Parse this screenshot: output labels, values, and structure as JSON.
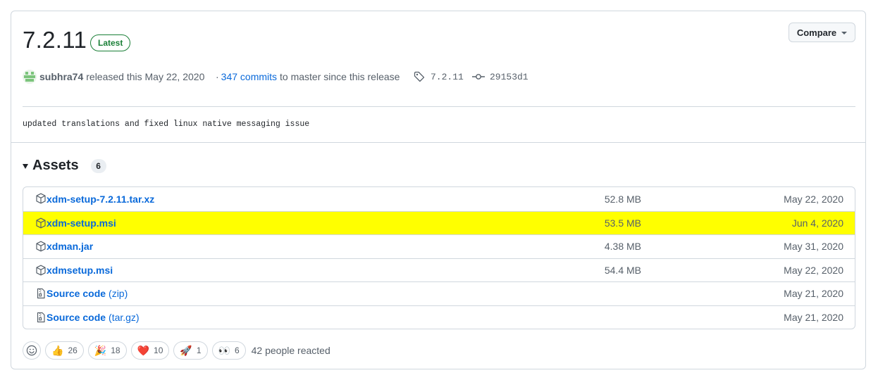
{
  "release": {
    "version": "7.2.11",
    "badge": "Latest",
    "compare_label": "Compare",
    "author": "subhra74",
    "released_text": "released this May 22, 2020",
    "commits_prefix": "·",
    "commits_link": "347 commits",
    "commits_suffix": "to master since this release",
    "tag": "7.2.11",
    "commit_hash": "29153d1",
    "notes": "updated translations and fixed linux native messaging issue"
  },
  "assets": {
    "title": "Assets",
    "count": "6",
    "rows": [
      {
        "name": "xdm-setup-7.2.11.tar.xz",
        "ext": "",
        "size": "52.8 MB",
        "date": "May 22, 2020",
        "icon": "package-icon",
        "highlight": false
      },
      {
        "name": "xdm-setup.msi",
        "ext": "",
        "size": "53.5 MB",
        "date": "Jun 4, 2020",
        "icon": "package-icon",
        "highlight": true
      },
      {
        "name": "xdman.jar",
        "ext": "",
        "size": "4.38 MB",
        "date": "May 31, 2020",
        "icon": "package-icon",
        "highlight": false
      },
      {
        "name": "xdmsetup.msi",
        "ext": "",
        "size": "54.4 MB",
        "date": "May 22, 2020",
        "icon": "package-icon",
        "highlight": false
      },
      {
        "name": "Source code",
        "ext": "(zip)",
        "size": "",
        "date": "May 21, 2020",
        "icon": "file-zip-icon",
        "highlight": false
      },
      {
        "name": "Source code",
        "ext": "(tar.gz)",
        "size": "",
        "date": "May 21, 2020",
        "icon": "file-zip-icon",
        "highlight": false
      }
    ]
  },
  "reactions": {
    "items": [
      {
        "emoji": "👍",
        "count": "26",
        "name": "thumbs-up"
      },
      {
        "emoji": "🎉",
        "count": "18",
        "name": "hooray"
      },
      {
        "emoji": "❤️",
        "count": "10",
        "name": "heart"
      },
      {
        "emoji": "🚀",
        "count": "1",
        "name": "rocket"
      },
      {
        "emoji": "👀",
        "count": "6",
        "name": "eyes"
      }
    ],
    "summary": "42 people reacted"
  },
  "colors": {
    "accent": "#0969da",
    "latest_green": "#1a7f37",
    "highlight": "#ffff00",
    "border": "#d0d7de"
  }
}
